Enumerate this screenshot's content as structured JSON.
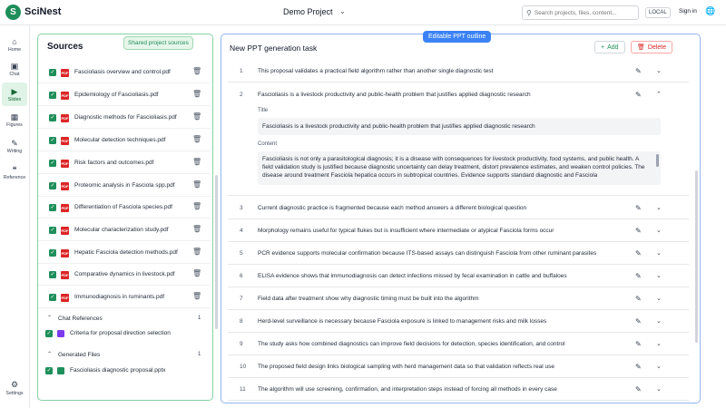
{
  "app": {
    "logo_letter": "S",
    "name": "SciNest"
  },
  "header": {
    "project": "Demo Project",
    "search_placeholder": "Search projects, files, content...",
    "local_label": "LOCAL",
    "signin_label": "Sign in"
  },
  "rail": {
    "items": [
      {
        "label": "Home",
        "icon": "home-icon"
      },
      {
        "label": "Chat",
        "icon": "chat-icon"
      },
      {
        "label": "Slides",
        "icon": "slides-icon",
        "active": true
      },
      {
        "label": "Figures",
        "icon": "figures-icon"
      },
      {
        "label": "Writing",
        "icon": "writing-icon"
      },
      {
        "label": "Reference",
        "icon": "reference-icon"
      }
    ],
    "settings_label": "Settings"
  },
  "sources": {
    "title": "Sources",
    "badge": "Shared project sources",
    "files": [
      "Fascioliasis overview and control.pdf",
      "Epidemiology of Fascioliasis.pdf",
      "Diagnostic methods for Fascioliasis.pdf",
      "Molecular detection techniques.pdf",
      "Risk factors and outcomes.pdf",
      "Proteomic analysis in Fasciola spp.pdf",
      "Differentiation of Fasciola species.pdf",
      "Molecular characterization study.pdf",
      "Hepatic Fasciola detection methods.pdf",
      "Comparative dynamics in livestock.pdf",
      "Immunodiagnosis in ruminants.pdf"
    ],
    "chat_references": {
      "label": "Chat References",
      "count": "1",
      "items": [
        "Criteria for proposal direction selection"
      ]
    },
    "generated_files": {
      "label": "Generated Files",
      "count": "1",
      "items": [
        "Fascioliasis diagnostic proposal.pptx"
      ]
    }
  },
  "main": {
    "badge": "Editable PPT outline",
    "title": "New PPT generation task",
    "add_label": "Add",
    "delete_label": "Delete",
    "outline": [
      {
        "num": "1",
        "text": "This proposal validates a practical field algorithm rather than another single diagnostic test"
      },
      {
        "num": "2",
        "text": "Fascioliasis is a livestock productivity and public-health problem that justifies applied diagnostic research"
      },
      {
        "num": "3",
        "text": "Current diagnostic practice is fragmented because each method answers a different biological question"
      },
      {
        "num": "4",
        "text": "Morphology remains useful for typical flukes but is insufficient where intermediate or atypical Fasciola forms occur"
      },
      {
        "num": "5",
        "text": "PCR evidence supports molecular confirmation because ITS-based assays can distinguish Fasciola from other ruminant parasites"
      },
      {
        "num": "6",
        "text": "ELISA evidence shows that immunodiagnosis can detect infections missed by fecal examination in cattle and buffaloes"
      },
      {
        "num": "7",
        "text": "Field data after treatment show why diagnostic timing must be built into the algorithm"
      },
      {
        "num": "8",
        "text": "Herd-level surveillance is necessary because Fasciola exposure is linked to management risks and milk losses"
      },
      {
        "num": "9",
        "text": "The study asks how combined diagnostics can improve field decisions for detection, species identification, and control"
      },
      {
        "num": "10",
        "text": "The proposed field design links biological sampling with herd management data so that validation reflects real use"
      },
      {
        "num": "11",
        "text": "The algorithm will use screening, confirmation, and interpretation steps instead of forcing all methods in every case"
      }
    ],
    "expanded": {
      "title_label": "Title",
      "title_value": "Fascioliasis is a livestock productivity and public-health problem that justifies applied diagnostic research",
      "content_label": "Content",
      "content_value": "Fascioliasis is not only a parasitological diagnosis; it is a disease with consequences for livestock productivity, food systems, and public health. A field validation study is justified because diagnostic uncertainty can delay treatment, distort prevalence estimates, and weaken control policies. The disease around treatment Fasciola hepatica occurs in subtropical countries. Evidence supports standard diagnostic and Fasciola"
    }
  }
}
